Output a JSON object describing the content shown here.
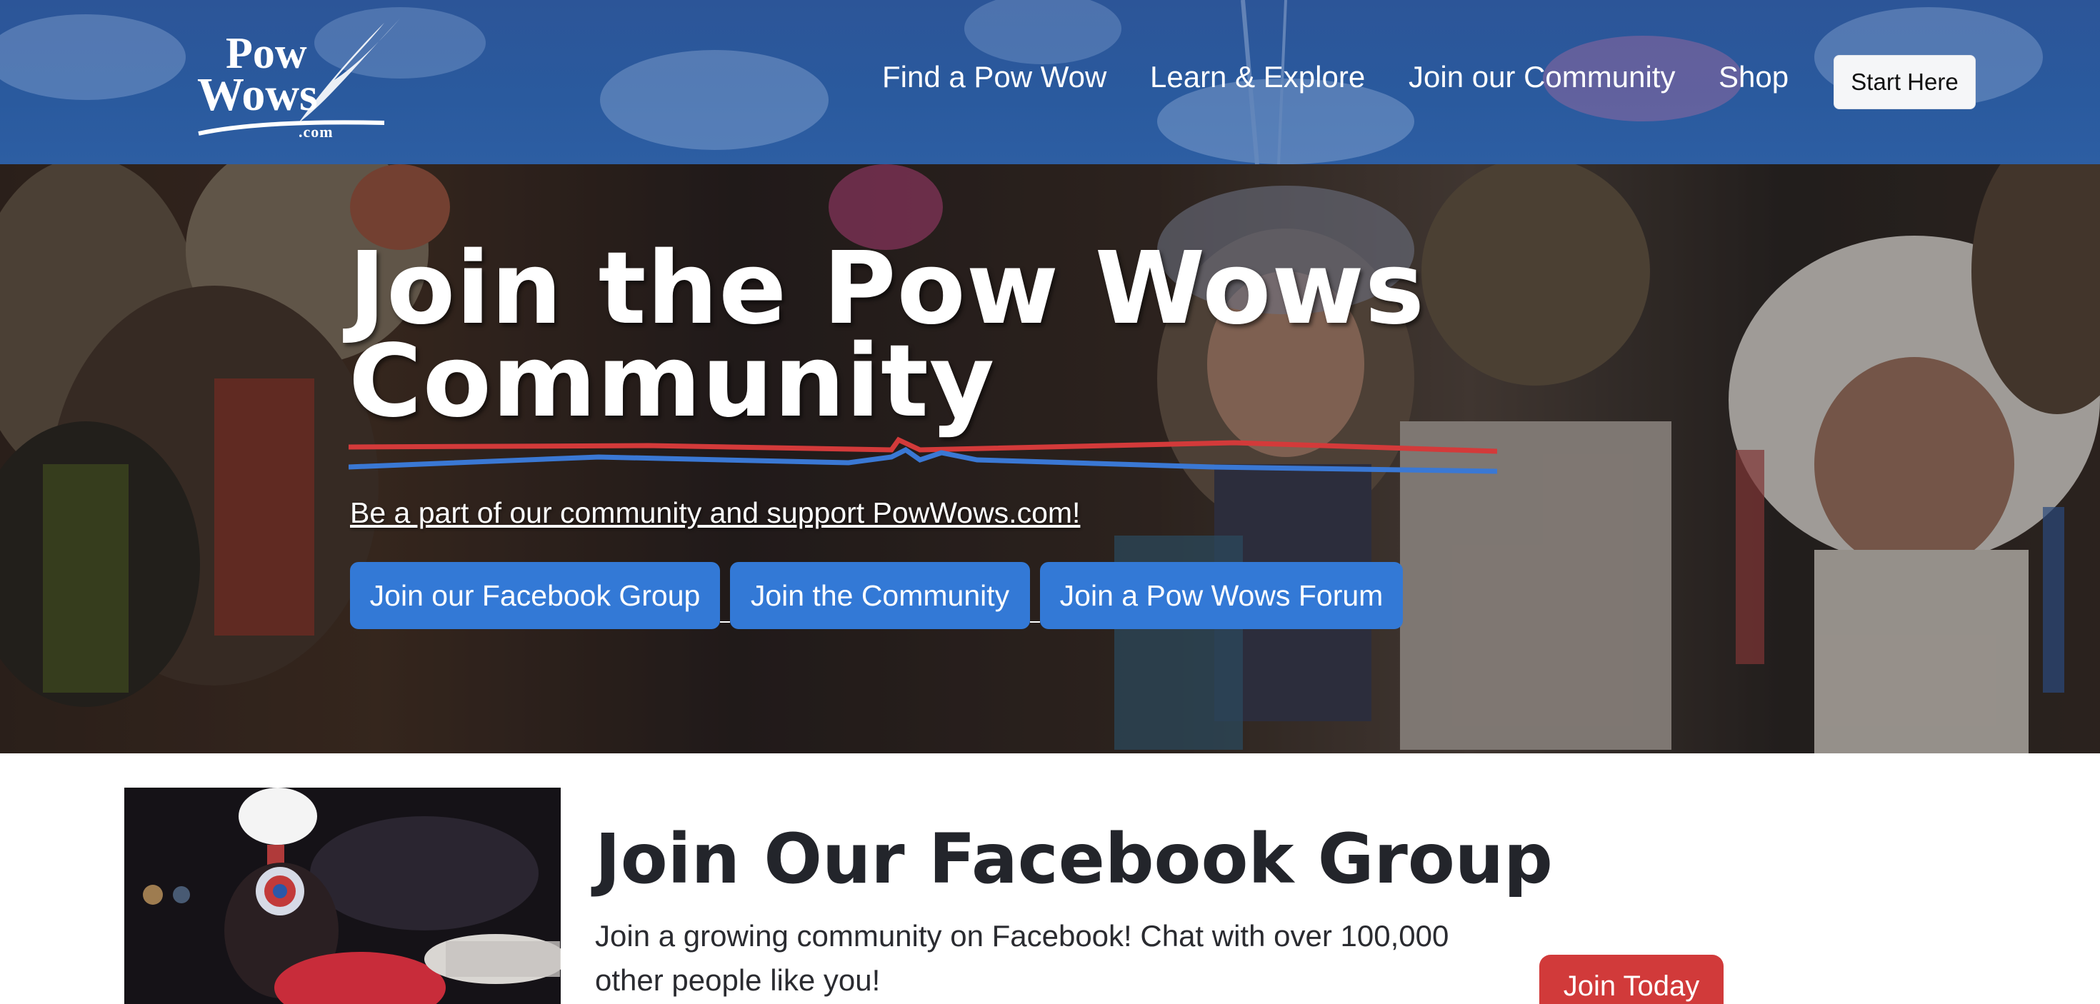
{
  "header": {
    "logo": {
      "word1": "Pow",
      "word2": "Wows",
      "suffix": ".com"
    },
    "nav": [
      {
        "label": "Find a Pow Wow"
      },
      {
        "label": "Learn & Explore"
      },
      {
        "label": "Join our Community"
      },
      {
        "label": "Shop"
      }
    ],
    "cta_label": "Start Here"
  },
  "hero": {
    "title_line1": "Join the Pow Wows",
    "title_line2": "Community",
    "subtitle": "Be a part of our community and support PowWows.com!",
    "buttons": [
      {
        "label": "Join our Facebook Group"
      },
      {
        "label": "Join the Community"
      },
      {
        "label": "Join a Pow Wows Forum"
      }
    ]
  },
  "facebook_section": {
    "title": "Join Our Facebook Group",
    "description": "Join a growing community on Facebook!  Chat with over 100,000 other people like you!",
    "button_label": "Join Today"
  },
  "colors": {
    "header_bg": "#2a5a9e",
    "hero_button": "#3379d6",
    "zigzag_red": "#d33a3a",
    "zigzag_blue": "#3a78d4",
    "join_today": "#d13a3a",
    "heading_text": "#23252b"
  }
}
